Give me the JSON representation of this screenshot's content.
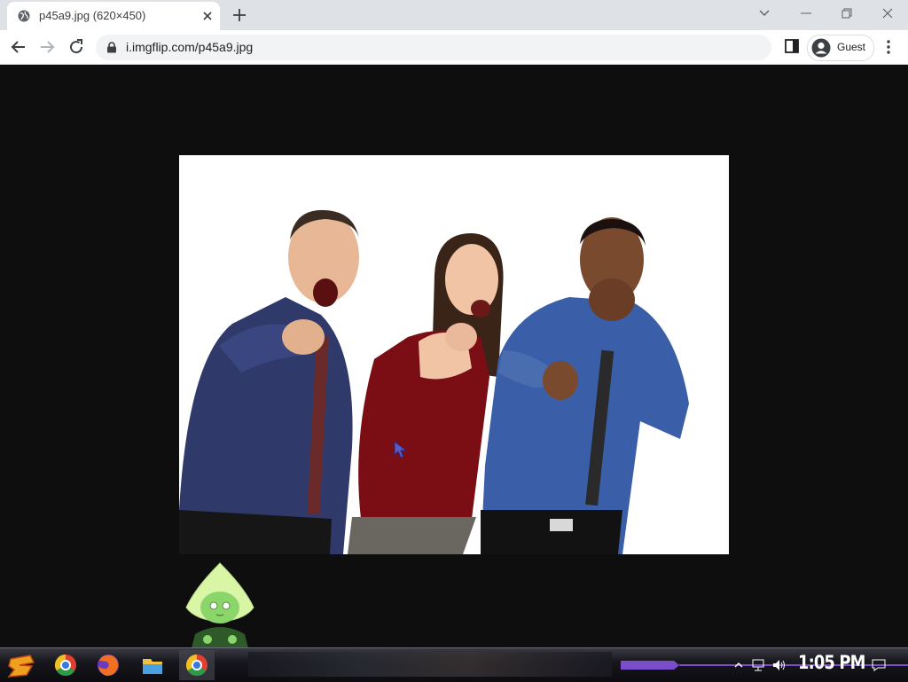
{
  "browser": {
    "tab": {
      "title": "p45a9.jpg (620×450)"
    },
    "url": "i.imgflip.com/p45a9.jpg",
    "profile_label": "Guest"
  },
  "taskbar": {
    "clock": "1:05 PM",
    "pinned": [
      "start-icon",
      "chrome-icon",
      "firefox-icon",
      "file-explorer-icon",
      "chrome-icon"
    ]
  },
  "colors": {
    "page_background": "#0e0e0e",
    "tabstrip": "#dee1e6",
    "taskbar_accent": "#7a4ec8"
  }
}
